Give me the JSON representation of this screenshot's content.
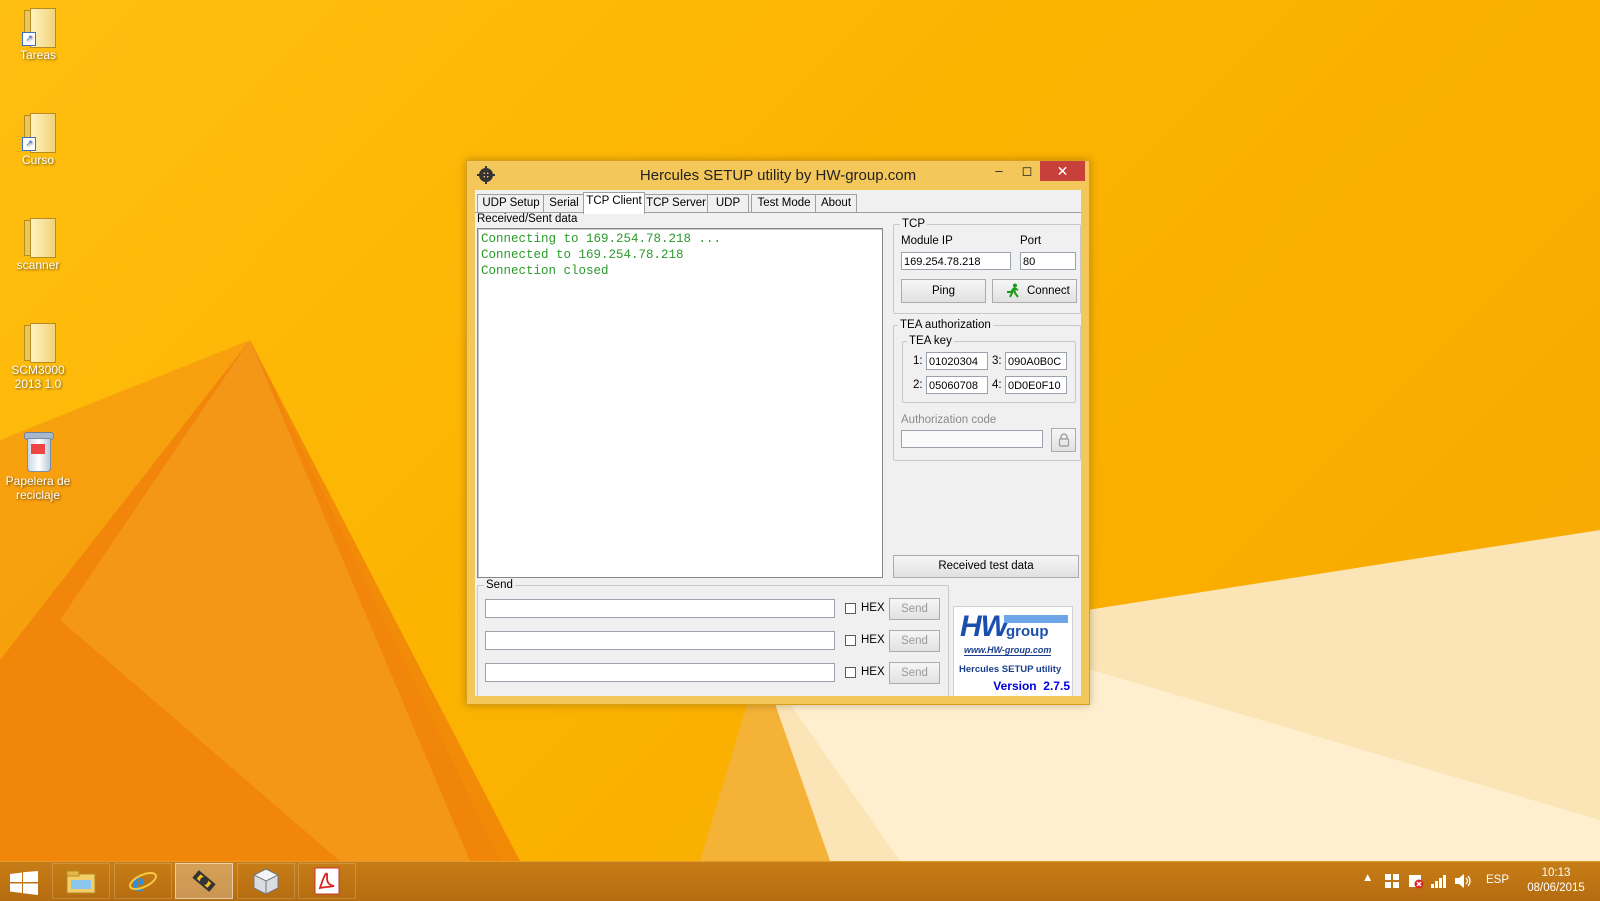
{
  "desktop": {
    "icons": [
      {
        "label": "Tareas",
        "icon": "folder-shortcut-icon"
      },
      {
        "label": "Curso",
        "icon": "folder-shortcut-icon"
      },
      {
        "label": "scanner",
        "icon": "folder-icon"
      },
      {
        "label": "SCM3000 2013 1.0",
        "icon": "folder-icon"
      },
      {
        "label": "Papelera de reciclaje",
        "icon": "recycle-bin-icon"
      }
    ]
  },
  "window": {
    "title": "Hercules SETUP utility by HW-group.com",
    "tabs": [
      "UDP Setup",
      "Serial",
      "TCP Client",
      "TCP Server",
      "UDP",
      "Test Mode",
      "About"
    ],
    "active_tab": "TCP Client",
    "received_label": "Received/Sent data",
    "received_lines": [
      "Connecting to 169.254.78.218 ...",
      "Connected to 169.254.78.218",
      "Connection closed"
    ],
    "received_color": "#2a9b2a",
    "tcp": {
      "group_label": "TCP",
      "module_ip_label": "Module IP",
      "module_ip_value": "169.254.78.218",
      "port_label": "Port",
      "port_value": "80",
      "ping_label": "Ping",
      "connect_label": "Connect"
    },
    "tea": {
      "group_label": "TEA authorization",
      "key_label": "TEA key",
      "keys": [
        {
          "index": "1:",
          "value": "01020304"
        },
        {
          "index": "2:",
          "value": "05060708"
        },
        {
          "index": "3:",
          "value": "090A0B0C"
        },
        {
          "index": "4:",
          "value": "0D0E0F10"
        }
      ],
      "auth_code_label": "Authorization code",
      "auth_code_value": ""
    },
    "received_test_label": "Received test data",
    "send": {
      "group_label": "Send",
      "rows": [
        {
          "value": "",
          "hex_label": "HEX",
          "send_label": "Send"
        },
        {
          "value": "",
          "hex_label": "HEX",
          "send_label": "Send"
        },
        {
          "value": "",
          "hex_label": "HEX",
          "send_label": "Send"
        }
      ]
    },
    "logo": {
      "brand_hw": "HW",
      "brand_group": "group",
      "url": "www.HW-group.com",
      "product": "Hercules SETUP utility",
      "version": "Version  2.7.5"
    }
  },
  "taskbar": {
    "apps": [
      "start-icon",
      "file-explorer-icon",
      "internet-explorer-icon",
      "hercules-icon",
      "virtualbox-icon",
      "adobe-reader-icon"
    ],
    "language": "ESP",
    "time": "10:13",
    "date": "08/06/2015"
  }
}
